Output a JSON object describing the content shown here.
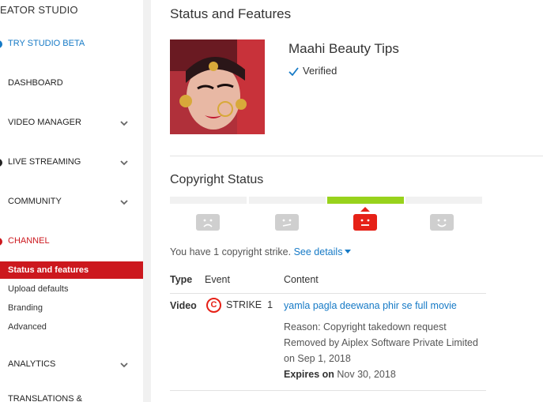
{
  "sidebar": {
    "title": "EATOR STUDIO",
    "try_beta": "TRY STUDIO BETA",
    "dashboard": "DASHBOARD",
    "video_manager": "VIDEO MANAGER",
    "live_streaming": "LIVE STREAMING",
    "community": "COMMUNITY",
    "channel": "CHANNEL",
    "sub_items": [
      "Status and features",
      "Upload defaults",
      "Branding",
      "Advanced"
    ],
    "analytics": "ANALYTICS",
    "translations": "TRANSLATIONS &"
  },
  "main": {
    "title": "Status and Features",
    "channel_name": "Maahi Beauty Tips",
    "verified_label": "Verified",
    "copyright_title": "Copyright Status",
    "strike_meter": {
      "strikes_active_segment": 3,
      "segments": 4
    },
    "strike_text": "You have 1 copyright strike.",
    "see_details": "See details",
    "table": {
      "headers": [
        "Type",
        "Event",
        "Content"
      ],
      "row": {
        "type": "Video",
        "event_icon": "C",
        "event": "STRIKE  1",
        "content_title": "yamla pagla deewana phir se full movie",
        "reason": "Reason: Copyright takedown request",
        "removed_by": "Removed by Aiplex Software Private Limited",
        "removed_on": "on Sep 1, 2018",
        "expires_label": "Expires on",
        "expires_date": "Nov 30, 2018"
      }
    }
  },
  "colors": {
    "accent_red": "#cc181e",
    "link_blue": "#167ac6",
    "meter_green": "#98d21c",
    "strike_red": "#e62117"
  },
  "icons": {
    "checkmark": "check-icon",
    "chevron": "chevron-down-icon",
    "copyright": "copyright-icon"
  }
}
